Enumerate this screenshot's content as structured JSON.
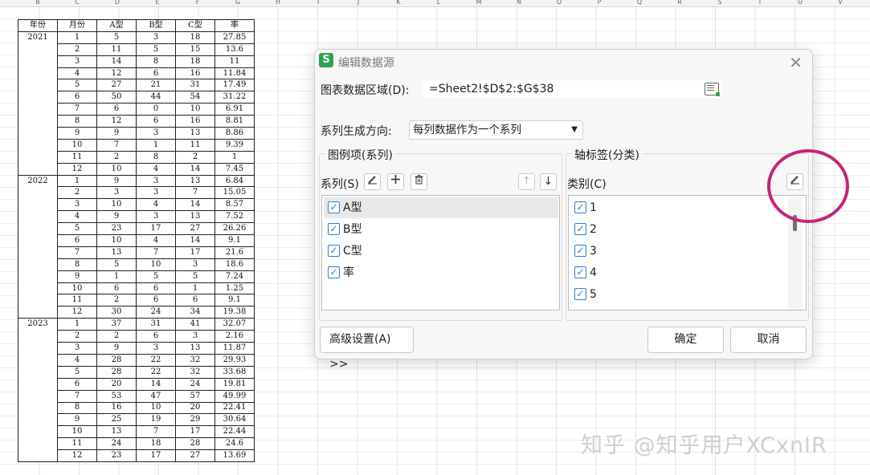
{
  "sheet": {
    "column_letters": [
      "B",
      "C",
      "D",
      "E",
      "F",
      "G",
      "H",
      "I",
      "J",
      "K",
      "L",
      "M",
      "N",
      "O",
      "P",
      "Q",
      "R",
      "S",
      "T",
      "U",
      "V"
    ],
    "table_headers": [
      "年份",
      "月份",
      "A型",
      "B型",
      "C型",
      "率"
    ],
    "rows": [
      {
        "year": "2021",
        "month": "1",
        "a": "5",
        "b": "3",
        "c": "18",
        "rate": "27.85"
      },
      {
        "year": "",
        "month": "2",
        "a": "11",
        "b": "5",
        "c": "15",
        "rate": "13.6"
      },
      {
        "year": "",
        "month": "3",
        "a": "14",
        "b": "8",
        "c": "18",
        "rate": "11"
      },
      {
        "year": "",
        "month": "4",
        "a": "12",
        "b": "6",
        "c": "16",
        "rate": "11.84"
      },
      {
        "year": "",
        "month": "5",
        "a": "27",
        "b": "21",
        "c": "31",
        "rate": "17.49"
      },
      {
        "year": "",
        "month": "6",
        "a": "50",
        "b": "44",
        "c": "54",
        "rate": "31.22"
      },
      {
        "year": "",
        "month": "7",
        "a": "6",
        "b": "0",
        "c": "10",
        "rate": "6.91"
      },
      {
        "year": "",
        "month": "8",
        "a": "12",
        "b": "6",
        "c": "16",
        "rate": "8.81"
      },
      {
        "year": "",
        "month": "9",
        "a": "9",
        "b": "3",
        "c": "13",
        "rate": "8.86"
      },
      {
        "year": "",
        "month": "10",
        "a": "7",
        "b": "1",
        "c": "11",
        "rate": "9.39"
      },
      {
        "year": "",
        "month": "11",
        "a": "2",
        "b": "8",
        "c": "2",
        "rate": "1"
      },
      {
        "year": "",
        "month": "12",
        "a": "10",
        "b": "4",
        "c": "14",
        "rate": "7.45"
      },
      {
        "year": "2022",
        "month": "1",
        "a": "9",
        "b": "3",
        "c": "13",
        "rate": "6.84"
      },
      {
        "year": "",
        "month": "2",
        "a": "3",
        "b": "3",
        "c": "7",
        "rate": "15.05"
      },
      {
        "year": "",
        "month": "3",
        "a": "10",
        "b": "4",
        "c": "14",
        "rate": "8.57"
      },
      {
        "year": "",
        "month": "4",
        "a": "9",
        "b": "3",
        "c": "13",
        "rate": "7.52"
      },
      {
        "year": "",
        "month": "5",
        "a": "23",
        "b": "17",
        "c": "27",
        "rate": "26.26"
      },
      {
        "year": "",
        "month": "6",
        "a": "10",
        "b": "4",
        "c": "14",
        "rate": "9.1"
      },
      {
        "year": "",
        "month": "7",
        "a": "13",
        "b": "7",
        "c": "17",
        "rate": "21.6"
      },
      {
        "year": "",
        "month": "8",
        "a": "5",
        "b": "10",
        "c": "3",
        "rate": "18.6"
      },
      {
        "year": "",
        "month": "9",
        "a": "1",
        "b": "5",
        "c": "5",
        "rate": "7.24"
      },
      {
        "year": "",
        "month": "10",
        "a": "6",
        "b": "6",
        "c": "1",
        "rate": "1.25"
      },
      {
        "year": "",
        "month": "11",
        "a": "2",
        "b": "6",
        "c": "6",
        "rate": "9.1"
      },
      {
        "year": "",
        "month": "12",
        "a": "30",
        "b": "24",
        "c": "34",
        "rate": "19.38"
      },
      {
        "year": "2023",
        "month": "1",
        "a": "37",
        "b": "31",
        "c": "41",
        "rate": "32.07"
      },
      {
        "year": "",
        "month": "2",
        "a": "2",
        "b": "6",
        "c": "3",
        "rate": "2.16"
      },
      {
        "year": "",
        "month": "3",
        "a": "9",
        "b": "3",
        "c": "13",
        "rate": "11.87"
      },
      {
        "year": "",
        "month": "4",
        "a": "28",
        "b": "22",
        "c": "32",
        "rate": "29.93"
      },
      {
        "year": "",
        "month": "5",
        "a": "28",
        "b": "22",
        "c": "32",
        "rate": "33.68"
      },
      {
        "year": "",
        "month": "6",
        "a": "20",
        "b": "14",
        "c": "24",
        "rate": "19.81"
      },
      {
        "year": "",
        "month": "7",
        "a": "53",
        "b": "47",
        "c": "57",
        "rate": "49.99"
      },
      {
        "year": "",
        "month": "8",
        "a": "16",
        "b": "10",
        "c": "20",
        "rate": "22.41"
      },
      {
        "year": "",
        "month": "9",
        "a": "25",
        "b": "19",
        "c": "29",
        "rate": "30.64"
      },
      {
        "year": "",
        "month": "10",
        "a": "13",
        "b": "7",
        "c": "17",
        "rate": "22.44"
      },
      {
        "year": "",
        "month": "11",
        "a": "24",
        "b": "18",
        "c": "28",
        "rate": "24.6"
      },
      {
        "year": "",
        "month": "12",
        "a": "23",
        "b": "17",
        "c": "27",
        "rate": "13.69"
      }
    ]
  },
  "dialog": {
    "app_icon_letter": "S",
    "title": "编辑数据源",
    "close_glyph": "✕",
    "range_label": "图表数据区域(D):",
    "range_value": "=Sheet2!$D$2:$G$38",
    "direction_label": "系列生成方向:",
    "direction_value": "每列数据作为一个系列",
    "legend_group_title": "图例项(系列)",
    "series_label": "系列(S)",
    "series_items": [
      "A型",
      "B型",
      "C型",
      "率"
    ],
    "axis_group_title": "轴标签(分类)",
    "category_label": "类别(C)",
    "category_items": [
      "1",
      "2",
      "3",
      "4",
      "5"
    ],
    "advanced_button": "高级设置(A) >>",
    "ok_button": "确定",
    "cancel_button": "取消"
  },
  "icons": {
    "edit": "edit-icon",
    "add": "plus-icon",
    "delete": "trash-icon",
    "move_up": "arrow-up-icon",
    "move_down": "arrow-down-icon",
    "checkmark": "checkmark-icon",
    "range_picker": "range-select-icon",
    "close": "close-icon"
  },
  "colors": {
    "app_icon": "#2ea44f",
    "checkbox": "#2f7ec8",
    "annotation_circle": "#c8237a"
  },
  "watermark": "知乎 @知乎用户XCxnIR"
}
